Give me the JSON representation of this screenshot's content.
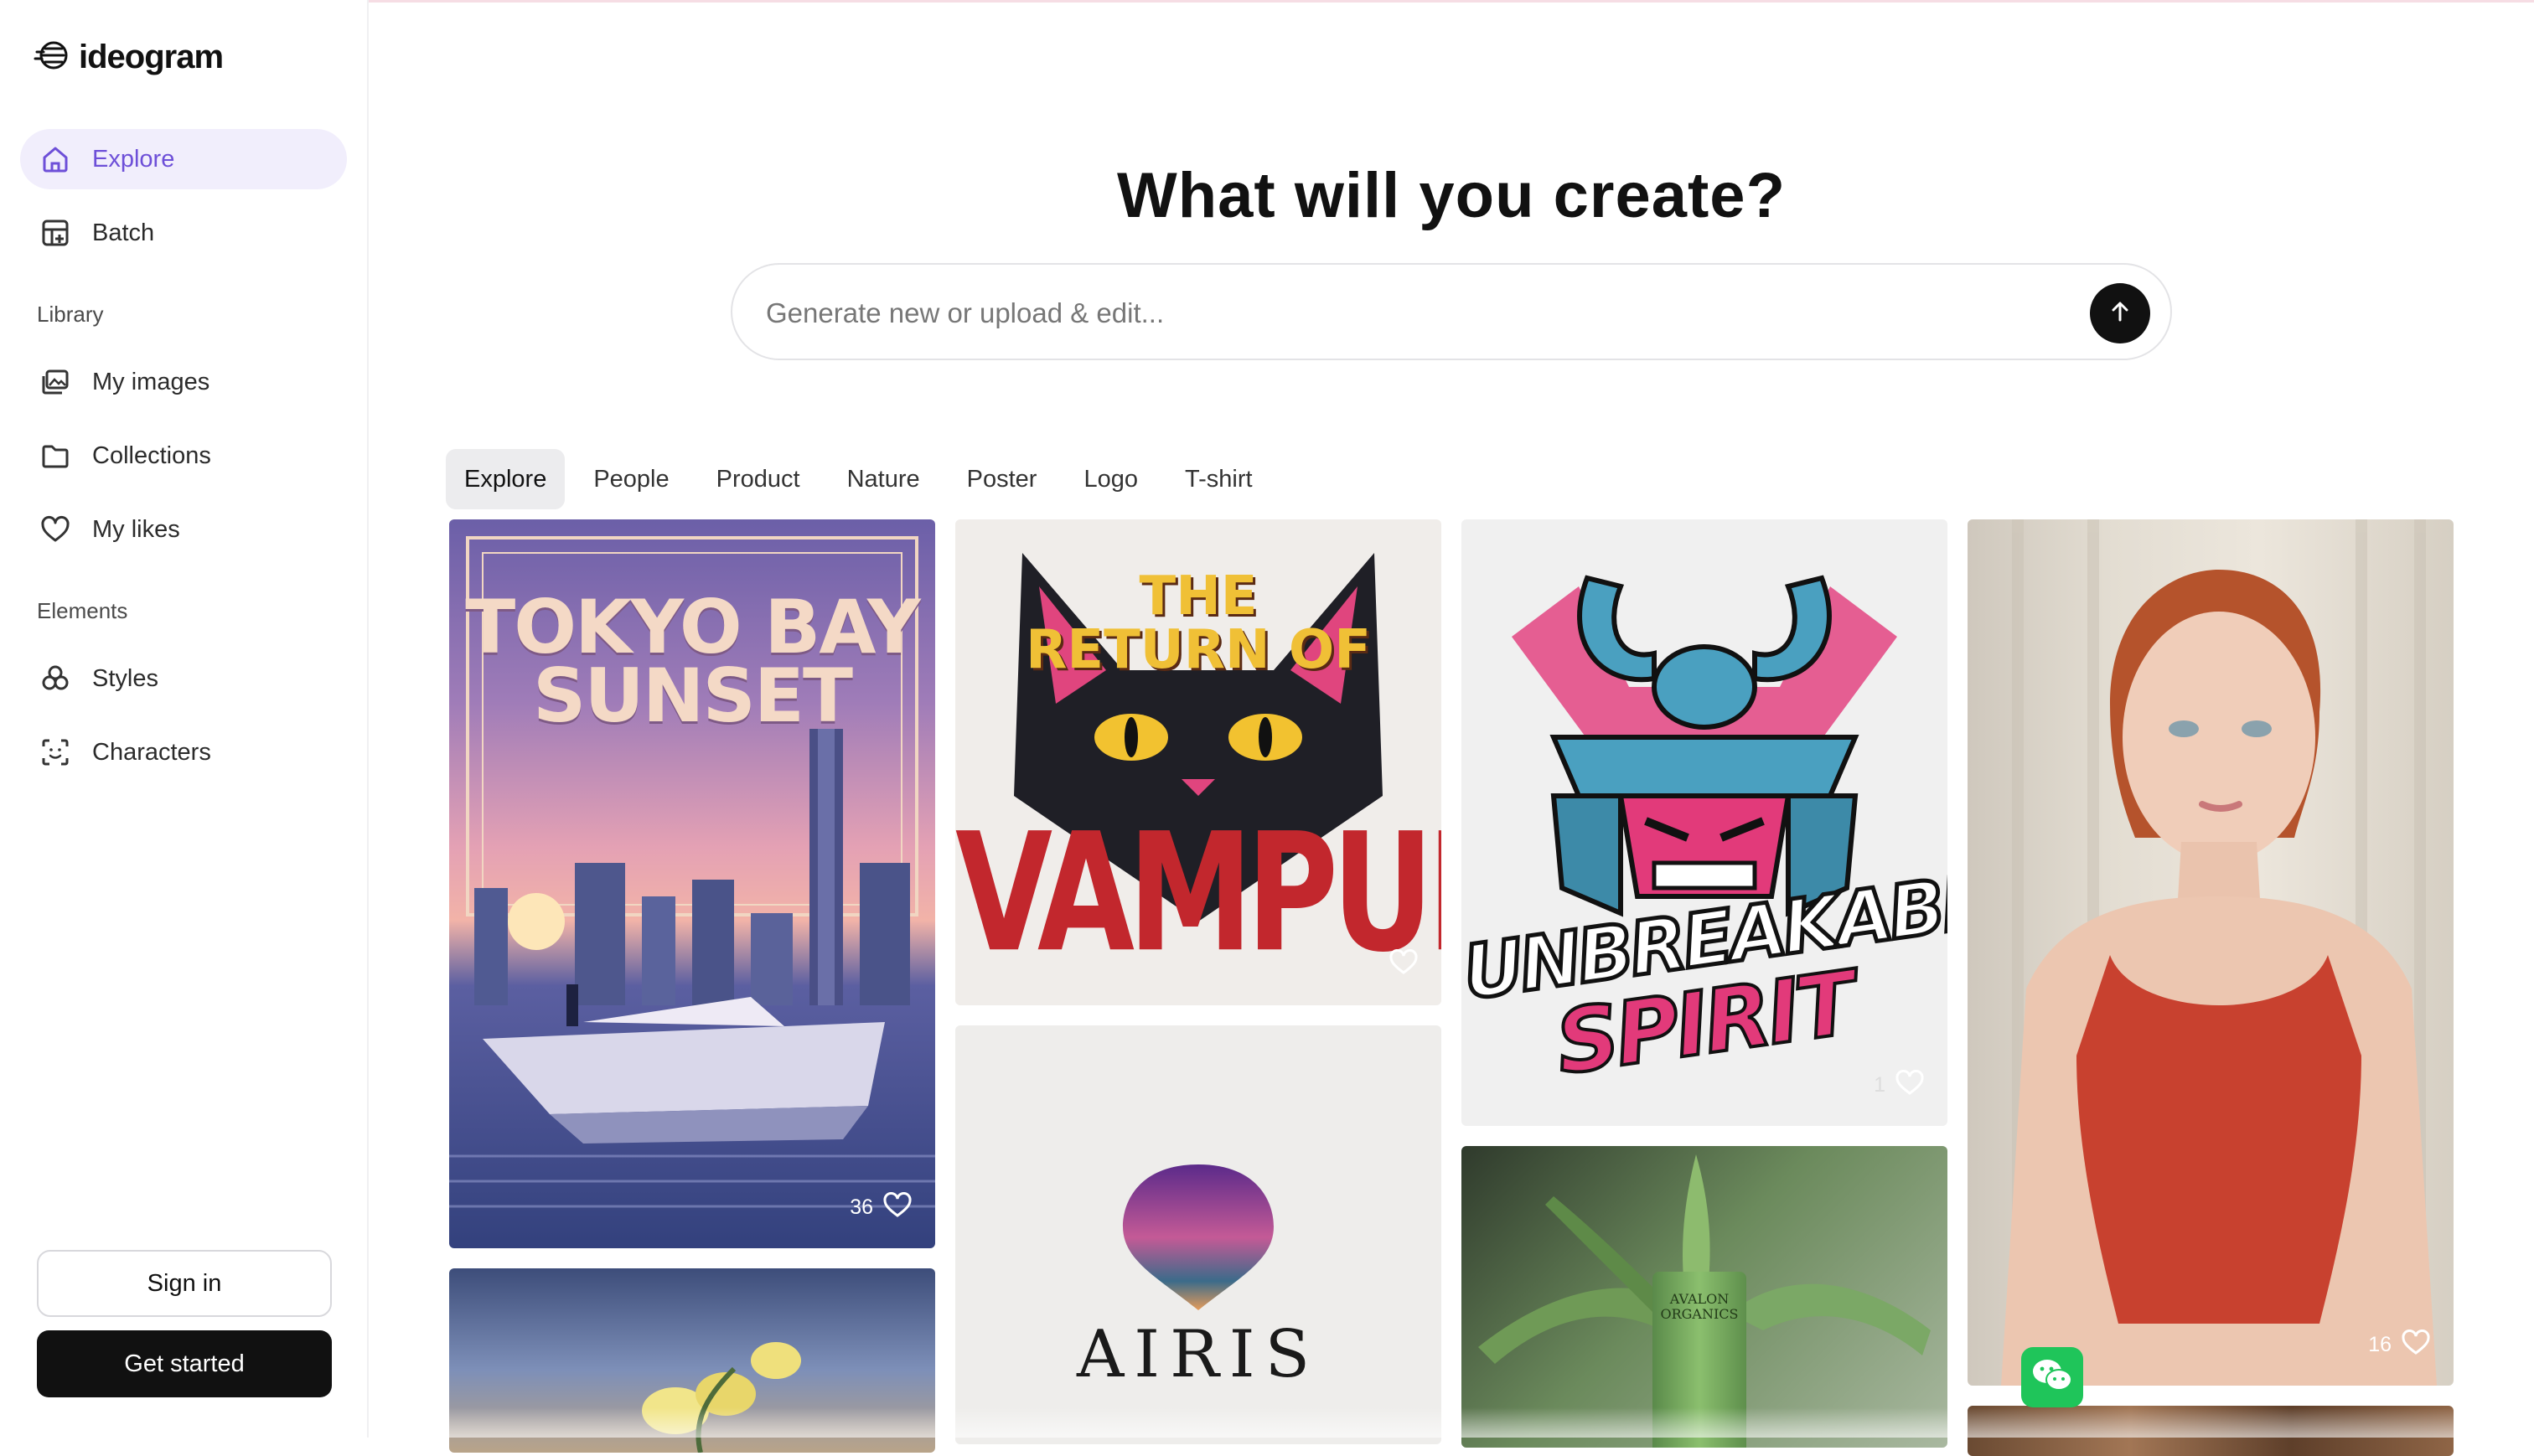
{
  "app": {
    "name": "ideogram"
  },
  "sidebar": {
    "primary": [
      {
        "label": "Explore",
        "icon": "home-icon",
        "active": true
      },
      {
        "label": "Batch",
        "icon": "batch-grid-icon",
        "active": false
      }
    ],
    "library_label": "Library",
    "library": [
      {
        "label": "My images",
        "icon": "images-icon"
      },
      {
        "label": "Collections",
        "icon": "folder-icon"
      },
      {
        "label": "My likes",
        "icon": "heart-icon"
      }
    ],
    "elements_label": "Elements",
    "elements": [
      {
        "label": "Styles",
        "icon": "styles-icon"
      },
      {
        "label": "Characters",
        "icon": "character-scan-icon"
      }
    ],
    "sign_in_label": "Sign in",
    "get_started_label": "Get started"
  },
  "main": {
    "title": "What will you create?",
    "prompt_placeholder": "Generate new or upload & edit...",
    "tabs": [
      {
        "label": "Explore",
        "active": true
      },
      {
        "label": "People"
      },
      {
        "label": "Product"
      },
      {
        "label": "Nature"
      },
      {
        "label": "Poster"
      },
      {
        "label": "Logo"
      },
      {
        "label": "T-shirt"
      }
    ]
  },
  "gallery": {
    "tokyo": {
      "title_line1": "TOKYO BAY",
      "title_line2": "SUNSET",
      "likes": "36"
    },
    "vampurr": {
      "line1": "THE",
      "line2": "RETURN OF",
      "line3": "VAMPURR"
    },
    "airis": {
      "text": "AIRIS"
    },
    "samurai": {
      "line1": "UNBREAKABLE",
      "line2": "SPIRIT",
      "likes": "1"
    },
    "aloe": {
      "brand_line1": "AVALON",
      "brand_line2": "ORGANICS"
    },
    "portrait": {
      "likes": "16"
    }
  },
  "colors": {
    "accent": "#6d4fd8",
    "active_bg": "#f1eefc",
    "button_dark": "#111111",
    "wechat_green": "#1fc55a"
  }
}
